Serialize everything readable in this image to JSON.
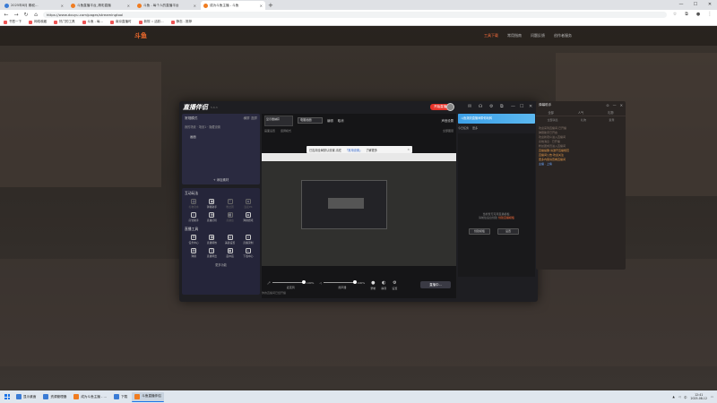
{
  "browser": {
    "tabs": [
      {
        "title": "2025年8月 期权…",
        "favicon": "blue",
        "active": false
      },
      {
        "title": "斗鱼直播平台_精彩直播",
        "favicon": "orange",
        "active": false
      },
      {
        "title": "斗鱼 - 每个人的直播平台",
        "favicon": "orange",
        "active": false
      },
      {
        "title": "成为斗鱼主播 - 斗鱼",
        "favicon": "orange",
        "active": true
      }
    ],
    "new_tab": "+",
    "url": "https://www.douyu.com/pages/streamingtool",
    "bookmarks": [
      "书签一下",
      "网络收藏",
      "热门的工具",
      "斗鱼 - 每…",
      "南京直播时",
      "新规 :: 活跃…",
      "静态 - 推荐"
    ]
  },
  "site": {
    "logo": "斗鱼",
    "nav": [
      {
        "label": "工具下载",
        "active": true
      },
      {
        "label": "常用指南",
        "active": false
      },
      {
        "label": "问题反馈",
        "active": false
      },
      {
        "label": "创作者服务",
        "active": false
      }
    ]
  },
  "app": {
    "brand": "直播伴侣",
    "version": "5.6.3",
    "live_button": "开始直播",
    "scene": {
      "title": "常规模式",
      "mode_options": [
        "横屏",
        "竖屏"
      ],
      "sub": "我的场景 · 场景1 · 隐藏设置",
      "item": "画面",
      "add": "+ 添加素材"
    },
    "interaction": {
      "title": "互动玩法",
      "items": [
        {
          "label": "礼物流水",
          "icon": "◎",
          "dim": true
        },
        {
          "label": "弹幕助手",
          "icon": "▣",
          "dim": false
        },
        {
          "label": "粉丝团",
          "icon": "♡",
          "dim": true
        },
        {
          "label": "连麦PK",
          "icon": "⚔",
          "dim": true
        },
        {
          "label": "房管助手",
          "icon": "⇩",
          "dim": false
        },
        {
          "label": "直播打榜",
          "icon": "▤",
          "dim": false
        },
        {
          "label": "点歌台",
          "icon": "▥",
          "dim": true
        },
        {
          "label": "弹幕游戏",
          "icon": "◈",
          "dim": false
        }
      ]
    },
    "tools": {
      "title": "直播工具",
      "items": [
        {
          "label": "任务中心",
          "icon": "☰"
        },
        {
          "label": "直播特效",
          "icon": "▦"
        },
        {
          "label": "美颜设置",
          "icon": "☺"
        },
        {
          "label": "直播录制",
          "icon": "⇩"
        },
        {
          "label": "弹幕",
          "icon": "▤"
        },
        {
          "label": "直播导出",
          "icon": "◫"
        },
        {
          "label": "画中画",
          "icon": "▣"
        },
        {
          "label": "下载中心",
          "icon": "⇣"
        }
      ],
      "more": "更多功能"
    },
    "topbar": {
      "source_thumb": "显示器捕获",
      "input_value": "电脑画面",
      "edit": "编辑",
      "cancel": "取消",
      "right_label": "声音设置"
    },
    "preview_toolbar": [
      "画面设置",
      "竖屏模式",
      "全部图层"
    ],
    "toast": {
      "text": "已应用全局默认设置,请在",
      "link": "「常用设置」",
      "tail": "了解更多",
      "close": "×"
    },
    "controls": {
      "mic_label": "麦克风",
      "mic_value": "100%",
      "speaker_label": "扬声器",
      "speaker_value": "100%",
      "record": "录制",
      "mute": "静音",
      "settings": "设置",
      "start": "直播中..."
    },
    "right": {
      "banner": "斗鱼潮流直播间带你玩转",
      "sub": [
        "今日任务",
        "更多"
      ],
      "message": "当前暂无可用直播模板,",
      "message2": "请前往后台创建",
      "message_hl": "创建直播模板",
      "buttons": [
        "创建模板",
        "设置"
      ]
    },
    "footer": "你的直播间已经开播"
  },
  "side_panel": {
    "title": "弹幕助手",
    "tabs": [
      "全部",
      "人气",
      "礼物"
    ],
    "sub": [
      "全部消息",
      "礼物",
      "贵宾"
    ],
    "lines": [
      {
        "text": "欢迎来到直播间,已开播",
        "cls": ""
      },
      {
        "text": "弹幕助手已开启",
        "cls": ""
      },
      {
        "text": "欢迎新观众进入直播间",
        "cls": ""
      },
      {
        "text": "系统消息 · 已开播",
        "cls": ""
      },
      {
        "text": "粉丝团成员进入直播间",
        "cls": ""
      },
      {
        "text": "直播提醒:请遵守直播规范",
        "cls": "hl"
      },
      {
        "text": "直播间公告:欢迎关注",
        "cls": "hl"
      },
      {
        "text": "更多内容请查看直播间",
        "cls": "hl"
      },
      {
        "text": "主播 · 上榜",
        "cls": "blue"
      }
    ]
  },
  "taskbar": {
    "items": [
      {
        "label": "显示桌面",
        "icon": "blue",
        "active": false
      },
      {
        "label": "资源管理器",
        "icon": "blue",
        "active": false
      },
      {
        "label": "成为斗鱼主播 - …",
        "icon": "orange",
        "active": false
      },
      {
        "label": "下载",
        "icon": "blue",
        "active": false
      },
      {
        "label": "斗鱼直播伴侣",
        "icon": "orange",
        "active": true
      }
    ],
    "time": "12:41",
    "date": "2025-08-12",
    "lang": "中"
  }
}
